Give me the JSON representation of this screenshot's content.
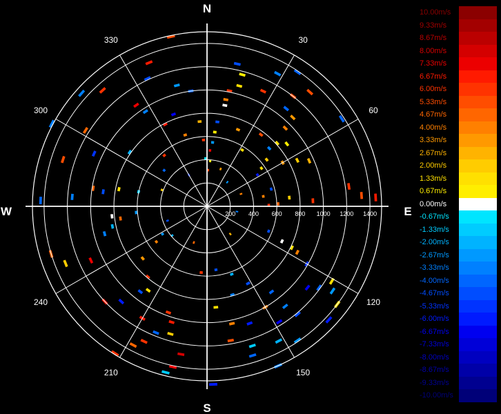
{
  "compass": {
    "north": "N",
    "south": "S",
    "east": "E",
    "west": "W"
  },
  "angle_labels": [
    {
      "deg": 30,
      "text": "30"
    },
    {
      "deg": 60,
      "text": "60"
    },
    {
      "deg": 120,
      "text": "120"
    },
    {
      "deg": 150,
      "text": "150"
    },
    {
      "deg": 210,
      "text": "210"
    },
    {
      "deg": 240,
      "text": "240"
    },
    {
      "deg": 300,
      "text": "300"
    },
    {
      "deg": 330,
      "text": "330"
    }
  ],
  "chart_data": {
    "type": "polar",
    "radial_axis": {
      "min": 0,
      "max": 1500,
      "ticks": [
        200,
        400,
        600,
        800,
        1000,
        1200,
        1400
      ]
    },
    "angle_grid_step_deg": 30,
    "colorbar": {
      "unit": "m/s",
      "entries": [
        {
          "label": "10.00m/s",
          "value": 10.0,
          "color": "#8b0000"
        },
        {
          "label": "9.33m/s",
          "value": 9.33,
          "color": "#a30000"
        },
        {
          "label": "8.67m/s",
          "value": 8.67,
          "color": "#bb0000"
        },
        {
          "label": "8.00m/s",
          "value": 8.0,
          "color": "#d40000"
        },
        {
          "label": "7.33m/s",
          "value": 7.33,
          "color": "#ec0000"
        },
        {
          "label": "6.67m/s",
          "value": 6.67,
          "color": "#ff1a00"
        },
        {
          "label": "6.00m/s",
          "value": 6.0,
          "color": "#ff3300"
        },
        {
          "label": "5.33m/s",
          "value": 5.33,
          "color": "#ff4d00"
        },
        {
          "label": "4.67m/s",
          "value": 4.67,
          "color": "#ff6600"
        },
        {
          "label": "4.00m/s",
          "value": 4.0,
          "color": "#ff8000"
        },
        {
          "label": "3.33m/s",
          "value": 3.33,
          "color": "#ff9900"
        },
        {
          "label": "2.67m/s",
          "value": 2.67,
          "color": "#ffb300"
        },
        {
          "label": "2.00m/s",
          "value": 2.0,
          "color": "#ffcc00"
        },
        {
          "label": "1.33m/s",
          "value": 1.33,
          "color": "#ffe000"
        },
        {
          "label": "0.67m/s",
          "value": 0.67,
          "color": "#ffee00"
        },
        {
          "label": "0.00m/s",
          "value": 0.0,
          "color": "#ffffff"
        },
        {
          "label": "-0.67m/s",
          "value": -0.67,
          "color": "#00e5ff"
        },
        {
          "label": "-1.33m/s",
          "value": -1.33,
          "color": "#00ccff"
        },
        {
          "label": "-2.00m/s",
          "value": -2.0,
          "color": "#00b3ff"
        },
        {
          "label": "-2.67m/s",
          "value": -2.67,
          "color": "#0099ff"
        },
        {
          "label": "-3.33m/s",
          "value": -3.33,
          "color": "#0080ff"
        },
        {
          "label": "-4.00m/s",
          "value": -4.0,
          "color": "#0066ff"
        },
        {
          "label": "-4.67m/s",
          "value": -4.67,
          "color": "#004dff"
        },
        {
          "label": "-5.33m/s",
          "value": -5.33,
          "color": "#0033ff"
        },
        {
          "label": "-6.00m/s",
          "value": -6.0,
          "color": "#001aff"
        },
        {
          "label": "-6.67m/s",
          "value": -6.67,
          "color": "#0000f0"
        },
        {
          "label": "-7.33m/s",
          "value": -7.33,
          "color": "#0000d8"
        },
        {
          "label": "-8.00m/s",
          "value": -8.0,
          "color": "#0000c0"
        },
        {
          "label": "-8.67m/s",
          "value": -8.67,
          "color": "#0000a8"
        },
        {
          "label": "-9.33m/s",
          "value": -9.33,
          "color": "#000090"
        },
        {
          "label": "-10.00m/s",
          "value": -10.0,
          "color": "#000078"
        }
      ]
    },
    "gates": [
      {
        "az": 15,
        "r": 1060,
        "v": 1.5
      },
      {
        "az": 15,
        "r": 1160,
        "v": 0.7
      },
      {
        "az": 12,
        "r": 1240,
        "v": -5.0
      },
      {
        "az": 10,
        "r": 870,
        "v": 0.0
      },
      {
        "az": 11,
        "r": 1000,
        "v": 6.0
      },
      {
        "az": 10,
        "r": 920,
        "v": 4.0
      },
      {
        "az": 7,
        "r": 720,
        "v": -4.7
      },
      {
        "az": 6,
        "r": 630,
        "v": 0.7
      },
      {
        "az": 5,
        "r": 540,
        "v": -2.7
      },
      {
        "az": 3,
        "r": 470,
        "v": 7.3
      },
      {
        "az": 2,
        "r": 300,
        "v": 5.3
      },
      {
        "az": 4,
        "r": 380,
        "v": 0.7
      },
      {
        "az": 22,
        "r": 700,
        "v": 3.3
      },
      {
        "az": 26,
        "r": 1090,
        "v": 6.0
      },
      {
        "az": 28,
        "r": 1280,
        "v": -3.3
      },
      {
        "az": 34,
        "r": 1380,
        "v": -4.0
      },
      {
        "az": 38,
        "r": 1190,
        "v": 5.3
      },
      {
        "az": 39,
        "r": 1070,
        "v": -4.0
      },
      {
        "az": 42,
        "r": 1310,
        "v": 5.3
      },
      {
        "az": 44,
        "r": 1050,
        "v": 3.3
      },
      {
        "az": 45,
        "r": 940,
        "v": 4.0
      },
      {
        "az": 48,
        "r": 800,
        "v": 1.3
      },
      {
        "az": 52,
        "r": 640,
        "v": 2.0
      },
      {
        "az": 55,
        "r": 560,
        "v": 1.3
      },
      {
        "az": 58,
        "r": 500,
        "v": -6.0
      },
      {
        "az": 60,
        "r": 740,
        "v": 3.3
      },
      {
        "az": 63,
        "r": 860,
        "v": 2.0
      },
      {
        "az": 57,
        "r": 1370,
        "v": -4.0
      },
      {
        "az": 66,
        "r": 950,
        "v": 2.7
      },
      {
        "az": 52,
        "r": 860,
        "v": 0.7
      },
      {
        "az": 47,
        "r": 720,
        "v": -3.3
      },
      {
        "az": 37,
        "r": 760,
        "v": 5.3
      },
      {
        "az": 32,
        "r": 560,
        "v": 1.3
      },
      {
        "az": 82,
        "r": 1220,
        "v": 6.0
      },
      {
        "az": 86,
        "r": 1320,
        "v": 5.3
      },
      {
        "az": 87,
        "r": 1440,
        "v": 6.7
      },
      {
        "az": 87,
        "r": 900,
        "v": 6.0
      },
      {
        "az": 84,
        "r": 700,
        "v": 2.0
      },
      {
        "az": 80,
        "r": 480,
        "v": 4.0
      },
      {
        "az": 89,
        "r": 520,
        "v": 6.0
      },
      {
        "az": 88,
        "r": 600,
        "v": 4.7
      },
      {
        "az": 75,
        "r": 560,
        "v": -4.7
      },
      {
        "az": 115,
        "r": 700,
        "v": 0.0
      },
      {
        "az": 116,
        "r": 800,
        "v": 1.3
      },
      {
        "az": 117,
        "r": 860,
        "v": 4.0
      },
      {
        "az": 112,
        "r": 560,
        "v": -4.7
      },
      {
        "az": 120,
        "r": 980,
        "v": -5.3
      },
      {
        "az": 121,
        "r": 1240,
        "v": 1.3
      },
      {
        "az": 124,
        "r": 1290,
        "v": -2.7
      },
      {
        "az": 126,
        "r": 1180,
        "v": -4.0
      },
      {
        "az": 127,
        "r": 1390,
        "v": 1.3
      },
      {
        "az": 129,
        "r": 1100,
        "v": -6.7
      },
      {
        "az": 133,
        "r": 1420,
        "v": -6.0
      },
      {
        "az": 140,
        "r": 1200,
        "v": -4.7
      },
      {
        "az": 142,
        "r": 1080,
        "v": -3.3
      },
      {
        "az": 143,
        "r": 910,
        "v": -4.0
      },
      {
        "az": 146,
        "r": 1380,
        "v": -2.7
      },
      {
        "az": 148,
        "r": 1160,
        "v": -6.7
      },
      {
        "az": 150,
        "r": 990,
        "v": 4.0
      },
      {
        "az": 152,
        "r": 740,
        "v": -4.7
      },
      {
        "az": 152,
        "r": 1300,
        "v": -2.0
      },
      {
        "az": 156,
        "r": 1490,
        "v": -3.3
      },
      {
        "az": 160,
        "r": 1060,
        "v": -6.0
      },
      {
        "az": 162,
        "r": 1250,
        "v": -1.3
      },
      {
        "az": 163,
        "r": 1330,
        "v": -4.0
      },
      {
        "az": 168,
        "r": 1020,
        "v": 4.0
      },
      {
        "az": 170,
        "r": 1160,
        "v": 5.3
      },
      {
        "az": 164,
        "r": 780,
        "v": -3.3
      },
      {
        "az": 160,
        "r": 610,
        "v": -2.0
      },
      {
        "az": 175,
        "r": 860,
        "v": 1.3
      },
      {
        "az": 178,
        "r": 1520,
        "v": -6.0
      },
      {
        "az": 172,
        "r": 540,
        "v": -4.7
      },
      {
        "az": 185,
        "r": 560,
        "v": 6.0
      },
      {
        "az": 190,
        "r": 1280,
        "v": 8.0
      },
      {
        "az": 192,
        "r": 1400,
        "v": 7.3
      },
      {
        "az": 194,
        "r": 1460,
        "v": -1.3
      },
      {
        "az": 196,
        "r": 1130,
        "v": 2.0
      },
      {
        "az": 197,
        "r": 1030,
        "v": 6.7
      },
      {
        "az": 200,
        "r": 960,
        "v": 6.0
      },
      {
        "az": 202,
        "r": 1160,
        "v": -4.0
      },
      {
        "az": 205,
        "r": 1270,
        "v": 6.0
      },
      {
        "az": 208,
        "r": 1340,
        "v": 4.7
      },
      {
        "az": 210,
        "r": 1100,
        "v": 6.7
      },
      {
        "az": 212,
        "r": 1480,
        "v": 6.0
      },
      {
        "az": 215,
        "r": 870,
        "v": 1.3
      },
      {
        "az": 218,
        "r": 920,
        "v": -4.7
      },
      {
        "az": 220,
        "r": 780,
        "v": 6.0
      },
      {
        "az": 222,
        "r": 1090,
        "v": -6.0
      },
      {
        "az": 227,
        "r": 1190,
        "v": 6.7
      },
      {
        "az": 231,
        "r": 700,
        "v": 3.3
      },
      {
        "az": 235,
        "r": 520,
        "v": 4.0
      },
      {
        "az": 238,
        "r": 440,
        "v": -2.7
      },
      {
        "az": 245,
        "r": 1090,
        "v": 7.3
      },
      {
        "az": 248,
        "r": 1300,
        "v": 2.0
      },
      {
        "az": 253,
        "r": 1390,
        "v": 4.7
      },
      {
        "az": 255,
        "r": 900,
        "v": -3.3
      },
      {
        "az": 258,
        "r": 820,
        "v": -2.0
      },
      {
        "az": 262,
        "r": 740,
        "v": 4.7
      },
      {
        "az": 264,
        "r": 810,
        "v": 0.0
      },
      {
        "az": 265,
        "r": 600,
        "v": -2.7
      },
      {
        "az": 272,
        "r": 1420,
        "v": -4.0
      },
      {
        "az": 274,
        "r": 1150,
        "v": -3.3
      },
      {
        "az": 278,
        "r": 890,
        "v": -4.7
      },
      {
        "az": 279,
        "r": 980,
        "v": 4.7
      },
      {
        "az": 281,
        "r": 760,
        "v": 1.3
      },
      {
        "az": 282,
        "r": 590,
        "v": -1.3
      },
      {
        "az": 288,
        "r": 1290,
        "v": 5.3
      },
      {
        "az": 295,
        "r": 1060,
        "v": -5.3
      },
      {
        "az": 298,
        "r": 1500,
        "v": -3.3
      },
      {
        "az": 302,
        "r": 1220,
        "v": 4.7
      },
      {
        "az": 305,
        "r": 800,
        "v": -2.0
      },
      {
        "az": 312,
        "r": 1440,
        "v": -3.3
      },
      {
        "az": 318,
        "r": 1330,
        "v": 6.0
      },
      {
        "az": 325,
        "r": 1050,
        "v": 7.3
      },
      {
        "az": 327,
        "r": 960,
        "v": -3.3
      },
      {
        "az": 333,
        "r": 780,
        "v": 6.7
      },
      {
        "az": 335,
        "r": 1200,
        "v": -4.7
      },
      {
        "az": 338,
        "r": 1320,
        "v": 6.7
      },
      {
        "az": 340,
        "r": 830,
        "v": -6.7
      },
      {
        "az": 343,
        "r": 630,
        "v": 4.0
      },
      {
        "az": 346,
        "r": 1060,
        "v": -2.7
      },
      {
        "az": 348,
        "r": 1480,
        "v": 5.3
      },
      {
        "az": 352,
        "r": 990,
        "v": -4.0
      },
      {
        "az": 355,
        "r": 720,
        "v": 2.7
      },
      {
        "az": 357,
        "r": 560,
        "v": 6.0
      },
      {
        "az": 358,
        "r": 400,
        "v": -0.7
      },
      {
        "az": 320,
        "r": 560,
        "v": 6.0
      },
      {
        "az": 310,
        "r": 470,
        "v": -4.0
      },
      {
        "az": 290,
        "r": 400,
        "v": 2.0
      },
      {
        "az": 250,
        "r": 350,
        "v": -4.7
      },
      {
        "az": 230,
        "r": 380,
        "v": -2.0
      },
      {
        "az": 200,
        "r": 320,
        "v": 4.7
      },
      {
        "az": 140,
        "r": 300,
        "v": 2.7
      },
      {
        "az": 100,
        "r": 250,
        "v": -3.3
      },
      {
        "az": 70,
        "r": 300,
        "v": 4.0
      },
      {
        "az": 40,
        "r": 260,
        "v": -2.7
      },
      {
        "az": 20,
        "r": 330,
        "v": 3.3
      },
      {
        "az": 330,
        "r": 300,
        "v": -5.3
      }
    ]
  }
}
